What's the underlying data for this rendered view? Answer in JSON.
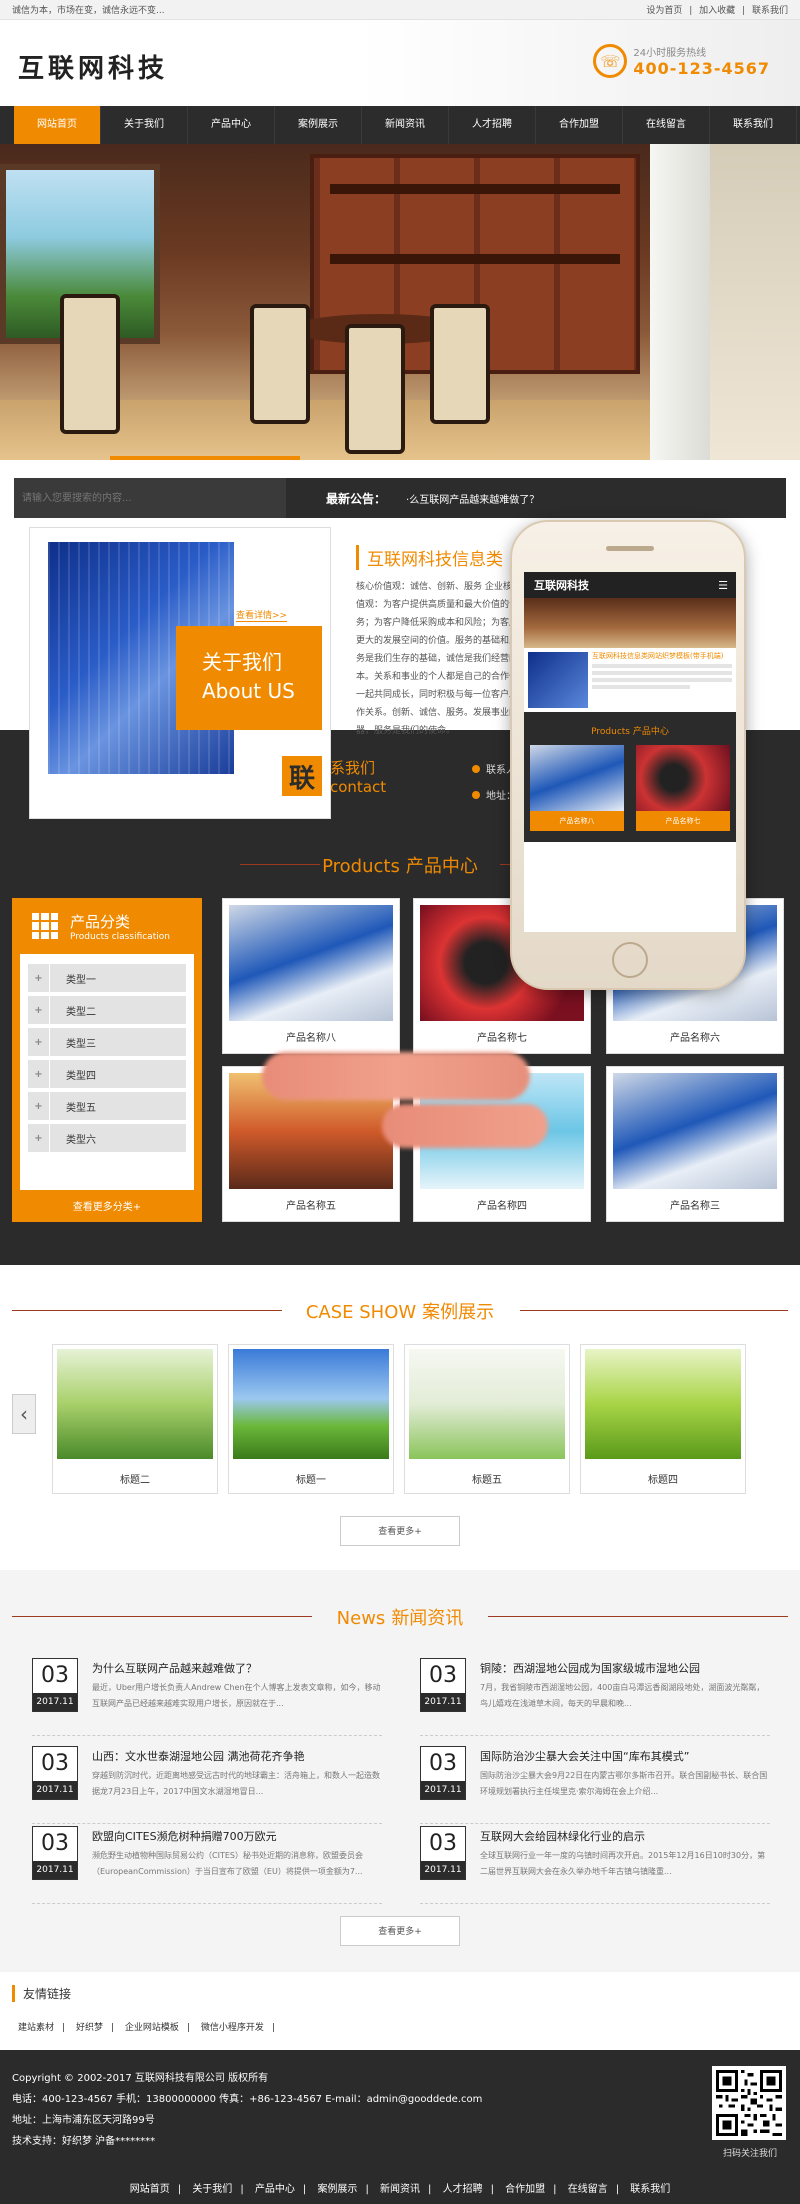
{
  "topbar": {
    "slogan": "诚信为本，市场在变，诚信永远不变...",
    "links": [
      "设为首页",
      "|",
      "加入收藏",
      "|",
      "联系我们"
    ]
  },
  "header": {
    "logo": "互联网科技",
    "hotline_label": "24小时服务热线",
    "hotline_number": "400-123-4567",
    "phone_icon": "phone-icon"
  },
  "nav": {
    "items": [
      "网站首页",
      "关于我们",
      "产品中心",
      "案例展示",
      "新闻资讯",
      "人才招聘",
      "合作加盟",
      "在线留言",
      "联系我们"
    ]
  },
  "search": {
    "placeholder": "请输入您要搜索的内容...",
    "notice_label": "最新公告：",
    "notice_text": "·么互联网产品越来越难做了？"
  },
  "about": {
    "card_cn": "关于我们",
    "card_en": "About US",
    "detail_link": "查看详情>>",
    "title": "互联网科技信息类",
    "text": "核心价值观：诚信、创新、服务 企业核心价值观：为客户提供高质量和最大价值的专业服务；为客户降低采购成本和风险；为客户提供更大的发展空间的价值。服务的基础和人，服务是我们生存的基础，诚信是我们经营的根本。关系和事业的个人都是自己的合作伙伴，一起共同成长，同时积极与每一位客户发展合作关系。创新、诚信、服务。发展事业的利器，服务是我们的使命。"
  },
  "contact": {
    "mark": "联",
    "cn": "系我们",
    "en": "contact",
    "lines": [
      "联系人：",
      "地址："
    ]
  },
  "products": {
    "title_en": "Products",
    "title_cn": "产品中心",
    "category_title": "产品分类",
    "category_sub": "Products classification",
    "categories": [
      "类型一",
      "类型二",
      "类型三",
      "类型四",
      "类型五",
      "类型六"
    ],
    "more": "查看更多分类+",
    "items": [
      "产品名称八",
      "产品名称七",
      "产品名称六",
      "产品名称五",
      "产品名称四",
      "产品名称三"
    ]
  },
  "phone_mockup": {
    "logo": "互联网科技",
    "title": "互联网科技信息类网站织梦模板(带手机端)",
    "section": "Products 产品中心",
    "prod_labels": [
      "产品名称八",
      "产品名称七"
    ]
  },
  "cases": {
    "title_en": "CASE SHOW",
    "title_cn": "案例展示",
    "items": [
      "标题二",
      "标题一",
      "标题五",
      "标题四"
    ],
    "arrow": "‹",
    "more": "查看更多+"
  },
  "news": {
    "title_en": "News",
    "title_cn": "新闻资讯",
    "items": [
      {
        "day": "03",
        "ym": "2017.11",
        "title": "为什么互联网产品越来越难做了？",
        "summary": "最近，Uber用户增长负责人Andrew Chen在个人博客上发表文章称，如今，移动互联网产品已经越来越难实现用户增长，原因就在于..."
      },
      {
        "day": "03",
        "ym": "2017.11",
        "title": "铜陵：西湖湿地公园成为国家级城市湿地公园",
        "summary": "7月，我省铜陵市西湖湿地公园，400亩白马潭远香阁湖段地处，湖面波光粼粼，鸟儿嬉戏在浅滩草木间，每天的早晨和晚..."
      },
      {
        "day": "03",
        "ym": "2017.11",
        "title": "山西：文水世泰湖湿地公园 满池荷花齐争艳",
        "summary": "穿越到防沉时代，近距离地感受远古时代的地球霸主：活舟箱上，和数人一起造数据龙7月23日上午，2017中国文水湖湿地冒日..."
      },
      {
        "day": "03",
        "ym": "2017.11",
        "title": "国际防治沙尘暴大会关注中国“库布其模式”",
        "summary": "国际防治沙尘暴大会9月22日在内蒙古鄂尔多斯市召开。联合国副秘书长、联合国环境规划署执行主任埃里克·索尔海姆在会上介绍..."
      },
      {
        "day": "03",
        "ym": "2017.11",
        "title": "欧盟向CITES濒危树种捐赠700万欧元",
        "summary": "濒危野生动植物种国际贸易公约（CITES）秘书处近期的消息称，欧盟委员会（EuropeanCommission）于当日宣布了欧盟（EU）将提供一项金额为7..."
      },
      {
        "day": "03",
        "ym": "2017.11",
        "title": "互联网大会给园林绿化行业的启示",
        "summary": "全球互联网行业一年一度的乌镇时间再次开启。2015年12月16日10时30分，第二届世界互联网大会在永久举办地千年古镇乌镇隆重..."
      }
    ],
    "more": "查看更多+"
  },
  "friend_links": {
    "title": "友情链接",
    "items": [
      "建站素材",
      "|",
      "好织梦",
      "|",
      "企业网站模板",
      "|",
      "微信小程序开发",
      "|"
    ]
  },
  "footer": {
    "copyright": "Copyright © 2002-2017 互联网科技有限公司 版权所有",
    "contacts": "电话：400-123-4567   手机：13800000000   传真：+86-123-4567   E-mail：admin@gooddede.com",
    "address": "地址：上海市浦东区天河路99号",
    "support": "技术支持：好织梦    沪备********",
    "qr_label": "扫码关注我们",
    "nav": [
      "网站首页",
      "|",
      "关于我们",
      "|",
      "产品中心",
      "|",
      "案例展示",
      "|",
      "新闻资讯",
      "|",
      "人才招聘",
      "|",
      "合作加盟",
      "|",
      "在线留言",
      "|",
      "联系我们"
    ]
  },
  "colors": {
    "accent": "#f08a00",
    "dark": "#2b2b2b"
  }
}
